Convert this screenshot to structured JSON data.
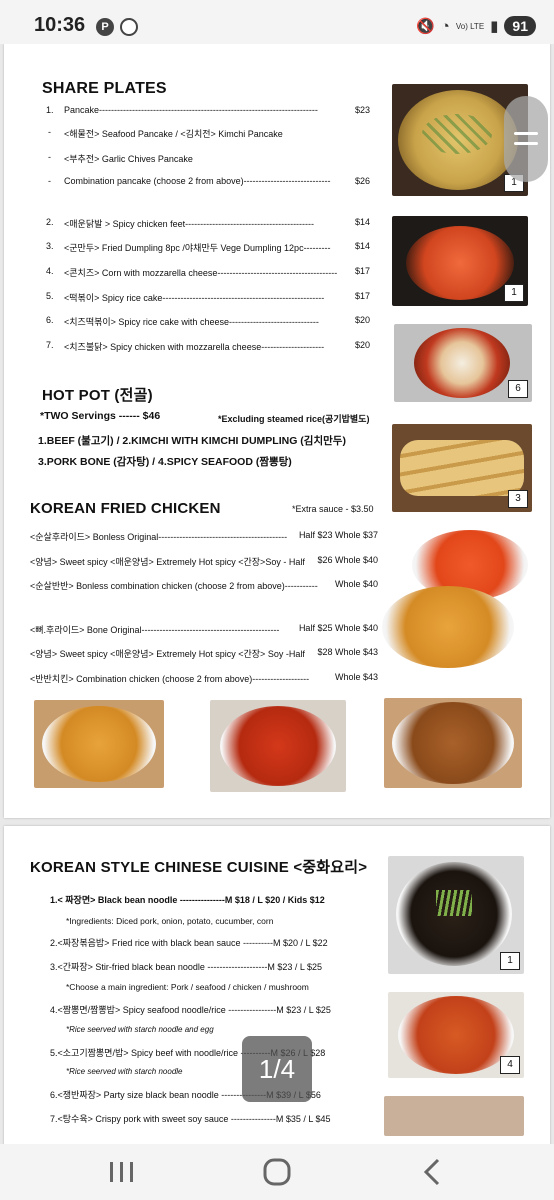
{
  "status": {
    "time": "10:36",
    "battery": "91",
    "network": "Vo) LTE"
  },
  "page_indicator": "1/4",
  "share_plates": {
    "title": "SHARE PLATES",
    "items": [
      {
        "num": "1.",
        "text": "Pancake-------------------------------------------------------------------------",
        "price": "$23"
      },
      {
        "num": "-",
        "text": "<해물전> Seafood Pancake / <김치전> Kimchi Pancake",
        "price": ""
      },
      {
        "num": "-",
        "text": "<부추전> Garlic Chives Pancake",
        "price": ""
      },
      {
        "num": "-",
        "text": "Combination pancake (choose 2 from above)-----------------------------",
        "price": "$26"
      },
      {
        "num": "2.",
        "text": "<매운닭발 > Spicy chicken feet-------------------------------------------",
        "price": "$14"
      },
      {
        "num": "3.",
        "text": "<군만두>  Fried Dumpling 8pc /야채만두 Vege Dumpling 12pc---------",
        "price": "$14"
      },
      {
        "num": "4.",
        "text": "<콘치즈> Corn with mozzarella cheese----------------------------------------",
        "price": "$17"
      },
      {
        "num": "5.",
        "text": "<떡볶이> Spicy rice cake------------------------------------------------------",
        "price": "$17"
      },
      {
        "num": "6.",
        "text": "<치즈떡볶이> Spicy rice cake with cheese------------------------------",
        "price": "$20"
      },
      {
        "num": "7.",
        "text": "<치즈불닭> Spicy chicken with mozzarella cheese---------------------",
        "price": "$20"
      }
    ]
  },
  "hot_pot": {
    "title": "HOT POT (전골)",
    "servings": "*TWO Servings ------ $46",
    "note": "*Excluding steamed rice(공기밥별도)",
    "line1": "1.BEEF (불고기) / 2.KIMCHI WITH KIMCHI DUMPLING (김치만두)",
    "line2": "3.PORK BONE (감자탕)   /   4.SPICY SEAFOOD (짬뽕탕)"
  },
  "fried_chicken": {
    "title": "KOREAN FRIED CHICKEN",
    "extra": "*Extra sauce - $3.50",
    "items": [
      {
        "text": "<순살후라이드> Bonless Original-------------------------------------------",
        "price": "Half $23 Whole $37"
      },
      {
        "text": "<양념> Sweet spicy <매운양념> Extremely Hot spicy <간장>Soy - Half",
        "price": "$26 Whole $40"
      },
      {
        "text": "<순살반반> Bonless combination chicken (choose 2 from above)-----------",
        "price": "Whole $40"
      },
      {
        "text": "<뼈.후라이드> Bone Original----------------------------------------------",
        "price": "Half $25 Whole $40"
      },
      {
        "text": "<양념> Sweet spicy <매운양념> Extremely Hot spicy <간장> Soy -Half",
        "price": "$28 Whole $43"
      },
      {
        "text": "<반반치킨> Combination chicken (choose 2 from above)-------------------",
        "price": "Whole $43"
      }
    ]
  },
  "chinese": {
    "title": "KOREAN STYLE CHINESE CUISINE <중화요리>",
    "items": [
      {
        "text": "1.<  짜장면> Black bean noodle ---------------M $18 / L $20 / Kids $12",
        "bold": true
      },
      {
        "text": "*Ingredients: Diced pork, onion, potato, cucumber, corn",
        "bold": false
      },
      {
        "text": "2.<짜장볶음밥> Fried rice with black bean sauce ----------M $20 / L $22",
        "bold": false
      },
      {
        "text": "3.<간짜장> Stir-fried black bean noodle --------------------M $23 / L $25",
        "bold": false
      },
      {
        "text": "*Choose a main ingredient: Pork / seafood / chicken / mushroom",
        "bold": false
      },
      {
        "text": "4.<짬뽕면/짬뽕밥> Spicy seafood noodle/rice ----------------M $23 / L $25",
        "bold": false
      },
      {
        "text": "*Rice seerved with starch noodle and egg",
        "bold": false
      },
      {
        "text": "5.<소고기짬뽕면/밥> Spicy beef with noodle/rice ----------M $26 / L $28",
        "bold": false
      },
      {
        "text": "*Rice seerved with starch noodle",
        "bold": false
      },
      {
        "text": "6.<쟁반짜장> Party size black bean noodle ---------------M $39 / L $56",
        "bold": false
      },
      {
        "text": "7.<탕수육> Crispy pork with sweet soy sauce ---------------M $35 / L $45",
        "bold": false
      }
    ]
  },
  "badges": {
    "pancake": "1",
    "spicy": "1",
    "tteok": "6",
    "dumpling": "3",
    "jjajang": "1",
    "jjamppong": "4"
  },
  "colors": {
    "battery_bg": "#333333",
    "pinterest": "#d0021b"
  }
}
